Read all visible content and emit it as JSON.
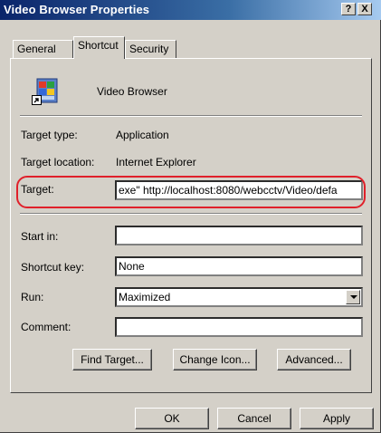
{
  "window": {
    "title": "Video Browser Properties",
    "help_glyph": "?",
    "close_glyph": "X"
  },
  "tabs": [
    {
      "label": "General"
    },
    {
      "label": "Shortcut"
    },
    {
      "label": "Security"
    }
  ],
  "header": {
    "app_name": "Video Browser"
  },
  "info": {
    "target_type_label": "Target type:",
    "target_type_value": "Application",
    "target_location_label": "Target location:",
    "target_location_value": "Internet Explorer"
  },
  "fields": {
    "target_label": "Target:",
    "target_value": "exe\" http://localhost:8080/webcctv/Video/defa",
    "start_in_label": "Start in:",
    "start_in_value": "",
    "shortcut_key_label": "Shortcut key:",
    "shortcut_key_value": "None",
    "run_label": "Run:",
    "run_value": "Maximized",
    "comment_label": "Comment:",
    "comment_value": ""
  },
  "buttons": {
    "find_target": "Find Target...",
    "change_icon": "Change Icon...",
    "advanced": "Advanced..."
  },
  "footer": {
    "ok": "OK",
    "cancel": "Cancel",
    "apply": "Apply"
  },
  "colors": {
    "title_bar": "#0a246a",
    "dialog_bg": "#d4d0c8",
    "highlight": "#e0202a"
  },
  "icons": {
    "app": "video-browser-app-icon",
    "shortcut_overlay": "shortcut-arrow-icon"
  }
}
